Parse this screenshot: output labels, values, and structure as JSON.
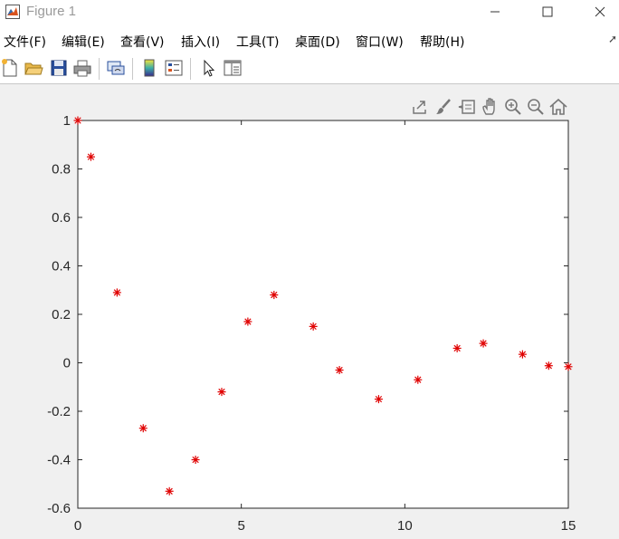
{
  "window": {
    "title": "Figure 1"
  },
  "menu": {
    "items": [
      {
        "label": "文件(F)"
      },
      {
        "label": "编辑(E)"
      },
      {
        "label": "查看(V)"
      },
      {
        "label": "插入(I)"
      },
      {
        "label": "工具(T)"
      },
      {
        "label": "桌面(D)"
      },
      {
        "label": "窗口(W)"
      },
      {
        "label": "帮助(H)"
      }
    ]
  },
  "toolbar": {
    "icons": [
      "new-figure-icon",
      "open-file-icon",
      "save-icon",
      "print-icon",
      "link-plot-icon",
      "insert-colorbar-icon",
      "insert-legend-icon",
      "edit-plot-arrow-icon",
      "property-inspector-icon"
    ]
  },
  "axes_toolbar": {
    "icons": [
      "export-icon",
      "brush-icon",
      "data-tips-icon",
      "pan-hand-icon",
      "zoom-in-icon",
      "zoom-out-icon",
      "home-icon"
    ]
  },
  "colors": {
    "marker": "#e00000",
    "axis": "#262626",
    "plot_bg": "#ffffff",
    "figure_bg": "#f0f0f0"
  },
  "chart_data": {
    "type": "scatter",
    "marker": "asterisk",
    "xlim": [
      0,
      15
    ],
    "ylim": [
      -0.6,
      1
    ],
    "xticks": [
      0,
      5,
      10,
      15
    ],
    "yticks": [
      -0.6,
      -0.4,
      -0.2,
      0,
      0.2,
      0.4,
      0.6,
      0.8,
      1
    ],
    "xtick_labels": [
      "0",
      "5",
      "10",
      "15"
    ],
    "ytick_labels": [
      "-0.6",
      "-0.4",
      "-0.2",
      "0",
      "0.2",
      "0.4",
      "0.6",
      "0.8",
      "1"
    ],
    "x": [
      0,
      0.4,
      1.2,
      2.0,
      2.8,
      3.6,
      4.4,
      5.2,
      6.0,
      7.2,
      8.0,
      9.2,
      10.4,
      11.6,
      12.4,
      13.6,
      14.4,
      15.0
    ],
    "y": [
      1.0,
      0.85,
      0.29,
      -0.27,
      -0.53,
      -0.4,
      -0.12,
      0.17,
      0.28,
      0.15,
      -0.03,
      -0.15,
      -0.07,
      0.06,
      0.08,
      0.035,
      -0.012,
      -0.016
    ],
    "grid": false
  }
}
